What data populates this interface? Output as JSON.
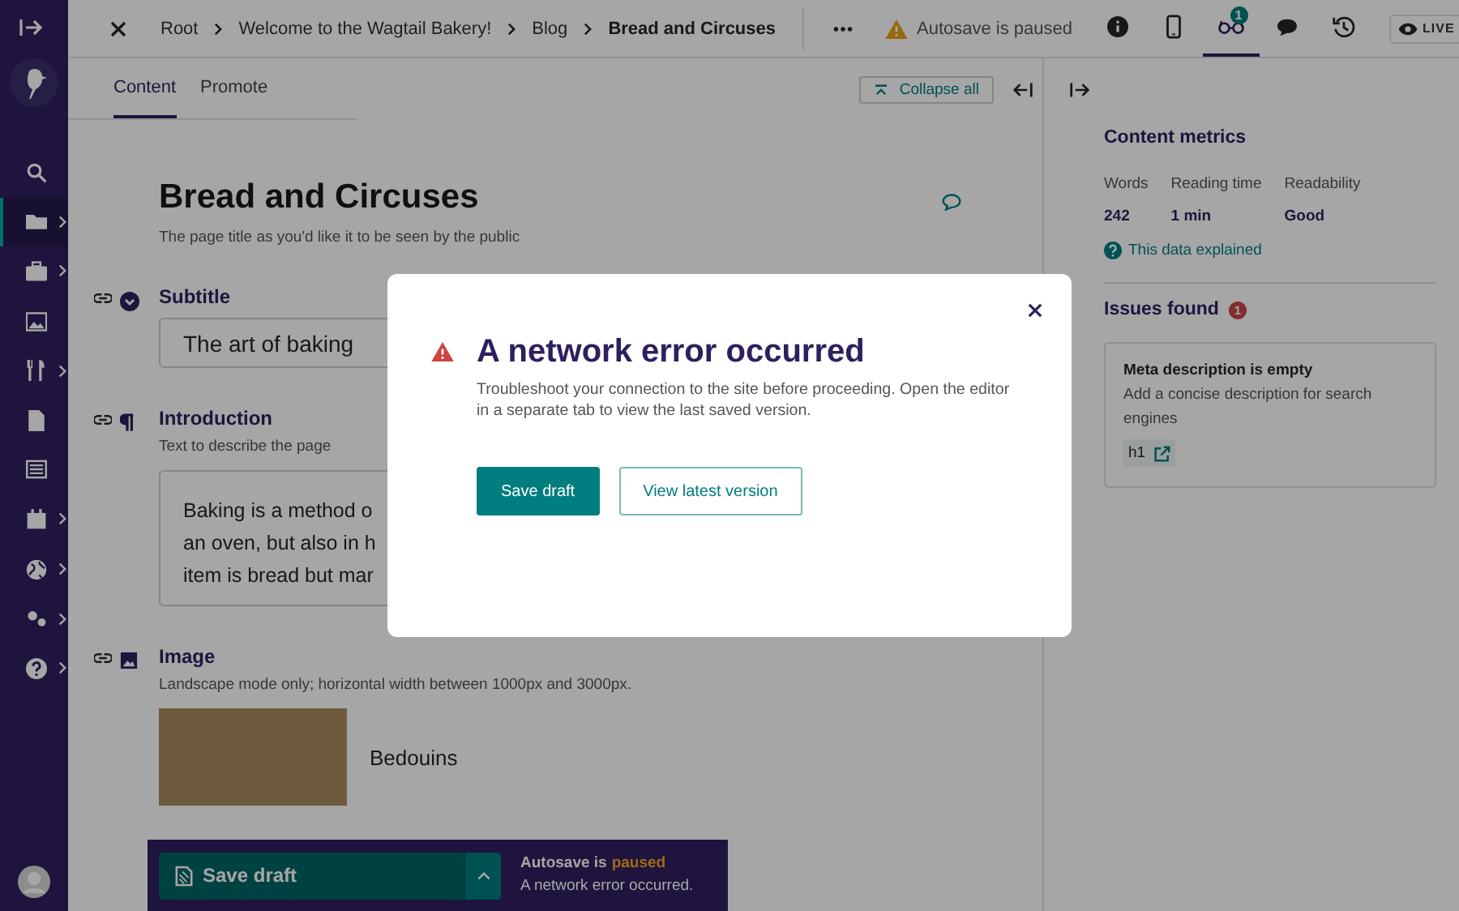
{
  "sidebar": {
    "items": [
      {
        "kind": "search",
        "expandable": false,
        "selected": false
      },
      {
        "kind": "folder",
        "expandable": true,
        "selected": true
      },
      {
        "kind": "briefcase",
        "expandable": true,
        "selected": false
      },
      {
        "kind": "image",
        "expandable": false,
        "selected": false
      },
      {
        "kind": "utensils",
        "expandable": true,
        "selected": false
      },
      {
        "kind": "document",
        "expandable": false,
        "selected": false
      },
      {
        "kind": "list",
        "expandable": false,
        "selected": false
      },
      {
        "kind": "calendar",
        "expandable": true,
        "selected": false
      },
      {
        "kind": "globe",
        "expandable": true,
        "selected": false
      },
      {
        "kind": "cogs",
        "expandable": true,
        "selected": false
      },
      {
        "kind": "help",
        "expandable": true,
        "selected": false
      }
    ]
  },
  "header": {
    "breadcrumbs": [
      "Root",
      "Welcome to the Wagtail Bakery!",
      "Blog",
      "Bread and Circuses"
    ],
    "status": "Autosave is paused",
    "toolbar": [
      {
        "kind": "info",
        "selected": false
      },
      {
        "kind": "mobile",
        "selected": false
      },
      {
        "kind": "glasses",
        "selected": true,
        "badge": "1"
      },
      {
        "kind": "comment",
        "selected": false
      },
      {
        "kind": "history",
        "selected": false
      }
    ],
    "live": "LIVE"
  },
  "tabs": [
    {
      "label": "Content",
      "selected": true
    },
    {
      "label": "Promote",
      "selected": false
    }
  ],
  "collapse_all": "Collapse all",
  "editor": {
    "title": "Bread and Circuses",
    "title_help": "The page title as you'd like it to be seen by the public",
    "fields": [
      {
        "kind": "text",
        "label": "Subtitle",
        "value": "The art of baking"
      },
      {
        "kind": "richtext",
        "label": "Introduction",
        "help": "Text to describe the page",
        "lines": [
          "Baking is a method o",
          "an oven, but also in h",
          "item is bread but mar"
        ]
      },
      {
        "kind": "image",
        "label": "Image",
        "help": "Landscape mode only; horizontal width between 1000px and 3000px.",
        "caption": "Bedouins"
      }
    ]
  },
  "panel": {
    "title": "Content metrics",
    "metrics": [
      {
        "label": "Words",
        "value": "242"
      },
      {
        "label": "Reading time",
        "value": "1 min"
      },
      {
        "label": "Readability",
        "value": "Good"
      }
    ],
    "help_link": "This data explained",
    "issues_title": "Issues found",
    "issues_count": "1",
    "issues": [
      {
        "title": "Meta description is empty",
        "text": "Add a concise description for search engines",
        "tag": "h1"
      }
    ]
  },
  "save_bar": {
    "button": "Save draft",
    "status": "Autosave is",
    "status_state": "paused",
    "message": "A network error occurred."
  },
  "modal": {
    "title": "A network error occurred",
    "text": "Troubleshoot your connection to the site before proceeding. Open the editor in a separate tab to view the last saved version.",
    "buttons": [
      {
        "label": "Save draft",
        "primary": true
      },
      {
        "label": "View latest version",
        "primary": false
      }
    ]
  }
}
